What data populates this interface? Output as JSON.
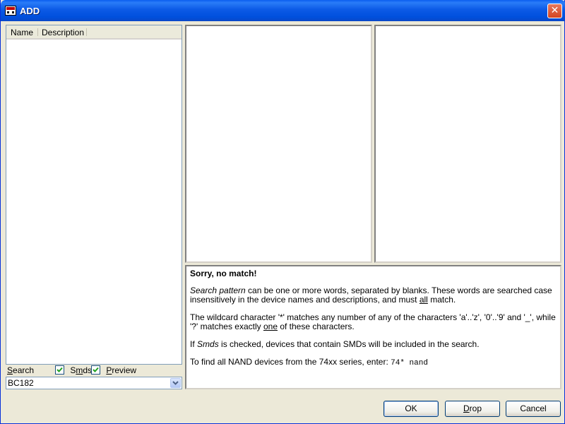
{
  "window": {
    "title": "ADD"
  },
  "list": {
    "columns": [
      "Name",
      "Description"
    ]
  },
  "search": {
    "label_accel": "S",
    "label_rest": "earch",
    "value": "BC182",
    "smds": {
      "checked": true,
      "pre": "S",
      "accel": "m",
      "post": "ds"
    },
    "preview": {
      "checked": true,
      "accel": "P",
      "post": "review"
    }
  },
  "info": {
    "heading": "Sorry, no match!",
    "p1_term": "Search pattern",
    "p1_text_a": " can be one or more words, separated by blanks. These words are searched case insensitively in the device names and descriptions, and must ",
    "p1_emph": "all",
    "p1_text_b": " match.",
    "p2_text_a": "The wildcard character '*' matches any number of any of the characters 'a'..'z', '0'..'9' and '_', while '?' matches exactly ",
    "p2_emph": "one",
    "p2_text_b": " of these characters.",
    "p3_text_a": "If ",
    "p3_term": "Smds",
    "p3_text_b": " is checked, devices that contain SMDs will be included in the search.",
    "p4_text": "To find all NAND devices from the 74xx series, enter: ",
    "p4_code": "74* nand"
  },
  "buttons": {
    "ok": "OK",
    "drop_accel": "D",
    "drop_rest": "rop",
    "cancel": "Cancel"
  },
  "colors": {
    "titlebar": "#0054e3",
    "face": "#ece9d8",
    "close": "#d34421"
  }
}
